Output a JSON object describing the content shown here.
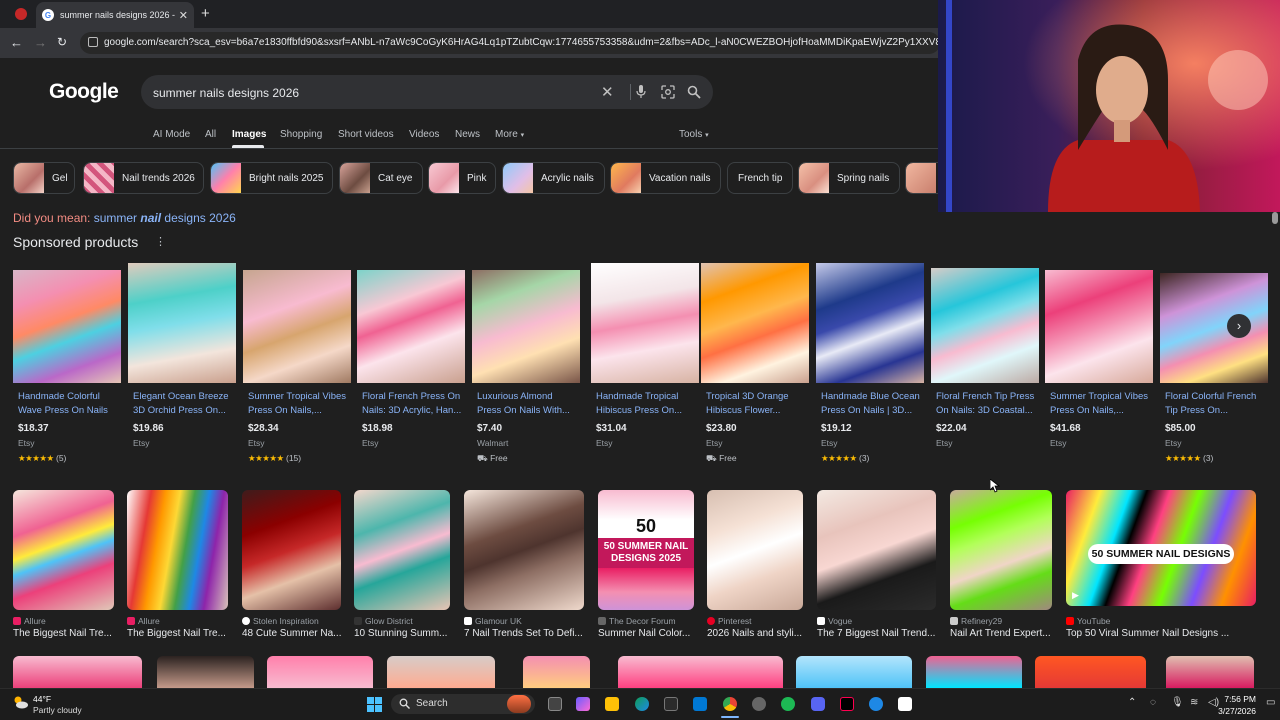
{
  "browser": {
    "tab_title": "summer nails designs 2026 - G",
    "url": "google.com/search?sca_esv=b6a7e1830ffbfd90&sxsrf=ANbL-n7aWc9CoGyK6HrAG4Lq1pTZubtCqw:1774655753358&udm=2&fbs=ADc_l-aN0CWEZBOHjofHoaMMDiKpaEWjvZ2Py1XXV8d8KvlI3o6iwGk6lV",
    "new_tab": "+",
    "close": "✕"
  },
  "google": {
    "logo": "Google",
    "query": "summer nails designs 2026",
    "tabs": [
      "AI Mode",
      "All",
      "Images",
      "Shopping",
      "Short videos",
      "Videos",
      "News",
      "More"
    ],
    "active_tab": "Images",
    "tools": "Tools"
  },
  "chips": [
    "Gel",
    "Nail trends 2026",
    "Bright nails 2025",
    "Cat eye",
    "Pink",
    "Acrylic nails",
    "Vacation nails",
    "French tip",
    "Spring nails"
  ],
  "did_you_mean": {
    "lead": "Did you mean:",
    "before": "summer",
    "bold": "nail",
    "after": "designs 2026"
  },
  "sponsored": {
    "title": "Sponsored products",
    "products": [
      {
        "title": "Handmade Colorful Wave Press On Nails ...",
        "price": "$18.37",
        "store": "Etsy",
        "stars": "★★★★★",
        "count": "(5)"
      },
      {
        "title": "Elegant Ocean Breeze 3D Orchid Press On...",
        "price": "$19.86",
        "store": "Etsy",
        "stars": "",
        "count": ""
      },
      {
        "title": "Summer Tropical Vibes Press On Nails,...",
        "price": "$28.34",
        "store": "Etsy",
        "stars": "★★★★★",
        "count": "(15)"
      },
      {
        "title": "Floral French Press On Nails: 3D Acrylic, Han...",
        "price": "$18.98",
        "store": "Etsy",
        "stars": "",
        "count": ""
      },
      {
        "title": "Luxurious Almond Press On Nails With...",
        "price": "$7.40",
        "store": "Walmart",
        "stars": "",
        "count": "Free"
      },
      {
        "title": "Handmade Tropical Hibiscus Press On...",
        "price": "$31.04",
        "store": "Etsy",
        "stars": "",
        "count": ""
      },
      {
        "title": "Tropical 3D Orange Hibiscus Flower...",
        "price": "$23.80",
        "store": "Etsy",
        "stars": "",
        "count": "Free"
      },
      {
        "title": "Handmade Blue Ocean Press On Nails | 3D...",
        "price": "$19.12",
        "store": "Etsy",
        "stars": "★★★★★",
        "count": "(3)"
      },
      {
        "title": "Floral French Tip Press On Nails: 3D Coastal...",
        "price": "$22.04",
        "store": "Etsy",
        "stars": "",
        "count": ""
      },
      {
        "title": "Summer Tropical Vibes Press On Nails,...",
        "price": "$41.68",
        "store": "Etsy",
        "stars": "",
        "count": ""
      },
      {
        "title": "Floral Colorful French Tip Press On...",
        "price": "$85.00",
        "store": "Etsy",
        "stars": "★★★★★",
        "count": "(3)"
      }
    ]
  },
  "images": [
    {
      "source": "Allure",
      "title": "The Biggest Nail Tre...",
      "overlay": ""
    },
    {
      "source": "Allure",
      "title": "The Biggest Nail Tre...",
      "overlay": ""
    },
    {
      "source": "Stolen Inspiration",
      "title": "48 Cute Summer Na...",
      "overlay": ""
    },
    {
      "source": "Glow District",
      "title": "10 Stunning Summ...",
      "overlay": ""
    },
    {
      "source": "Glamour UK",
      "title": "7 Nail Trends Set To Defi...",
      "overlay": ""
    },
    {
      "source": "The Decor Forum",
      "title": "Summer Nail Color...",
      "overlay": "50 SUMMER NAIL DESIGNS 2025"
    },
    {
      "source": "Pinterest",
      "title": "2026 Nails and styli...",
      "overlay": ""
    },
    {
      "source": "Vogue",
      "title": "The 7 Biggest Nail Trend...",
      "overlay": ""
    },
    {
      "source": "Refinery29",
      "title": "Nail Art Trend Expert...",
      "overlay": ""
    },
    {
      "source": "YouTube",
      "title": "Top 50 Viral Summer Nail Designs ...",
      "overlay": "50 SUMMER NAIL DESIGNS"
    }
  ],
  "taskbar": {
    "temp": "44°F",
    "condition": "Partly cloudy",
    "search": "Search",
    "time": "7:56 PM",
    "date": "3/27/2026"
  }
}
